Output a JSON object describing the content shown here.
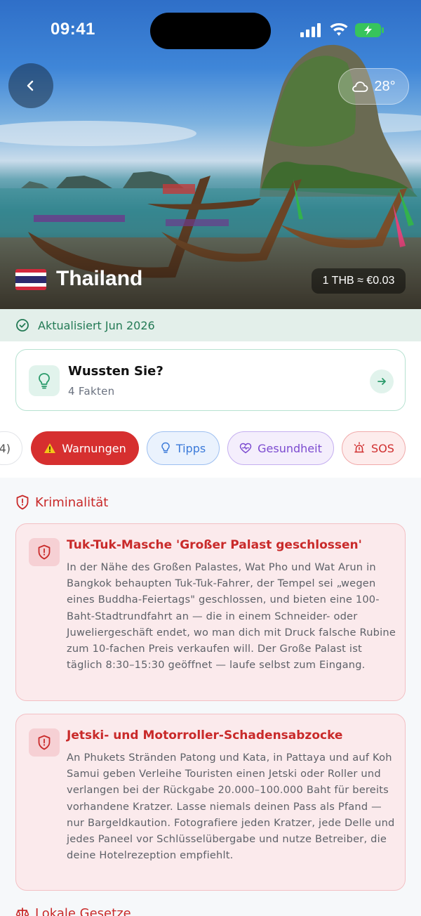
{
  "status_bar": {
    "time": "09:41"
  },
  "hero": {
    "weather": {
      "icon": "cloud-icon",
      "temperature": "28°"
    },
    "country": "Thailand",
    "flag": "thailand-flag",
    "exchange_rate": "1 THB ≈ €0.03"
  },
  "updated": {
    "label": "Aktualisiert Jun 2026",
    "icon": "check-circle-icon"
  },
  "facts": {
    "title": "Wussten Sie?",
    "subtitle": "4 Fakten"
  },
  "chips": {
    "partial": "4)",
    "warnings": "Warnungen",
    "tips": "Tipps",
    "health": "Gesundheit",
    "sos": "SOS"
  },
  "sections": {
    "crime": {
      "title": "Kriminalität",
      "items": [
        {
          "title": "Tuk-Tuk-Masche 'Großer Palast geschlossen'",
          "body": "In der Nähe des Großen Palastes, Wat Pho und Wat Arun in Bangkok behaupten Tuk-Tuk-Fahrer, der Tempel sei „wegen eines Buddha-Feiertags\" geschlossen, und bieten eine 100-Baht-Stadtrundfahrt an — die in einem Schneider- oder Juweliergeschäft endet, wo man dich mit Druck falsche Rubine zum 10-fachen Preis verkaufen will. Der Große Palast ist täglich 8:30–15:30 geöffnet — laufe selbst zum Eingang."
        },
        {
          "title": "Jetski- und Motorroller-Schadensabzocke",
          "body": "An Phukets Stränden Patong und Kata, in Pattaya und auf Koh Samui geben Verleihe Touristen einen Jetski oder Roller und verlangen bei der Rückgabe 20.000–100.000 Baht für bereits vorhandene Kratzer. Lasse niemals deinen Pass als Pfand — nur Bargeldkaution. Fotografiere jeden Kratzer, jede Delle und jedes Paneel vor Schlüsselübergabe und nutze Betreiber, die deine Hotelrezeption empfiehlt."
        }
      ]
    },
    "laws": {
      "title": "Lokale Gesetze"
    }
  }
}
